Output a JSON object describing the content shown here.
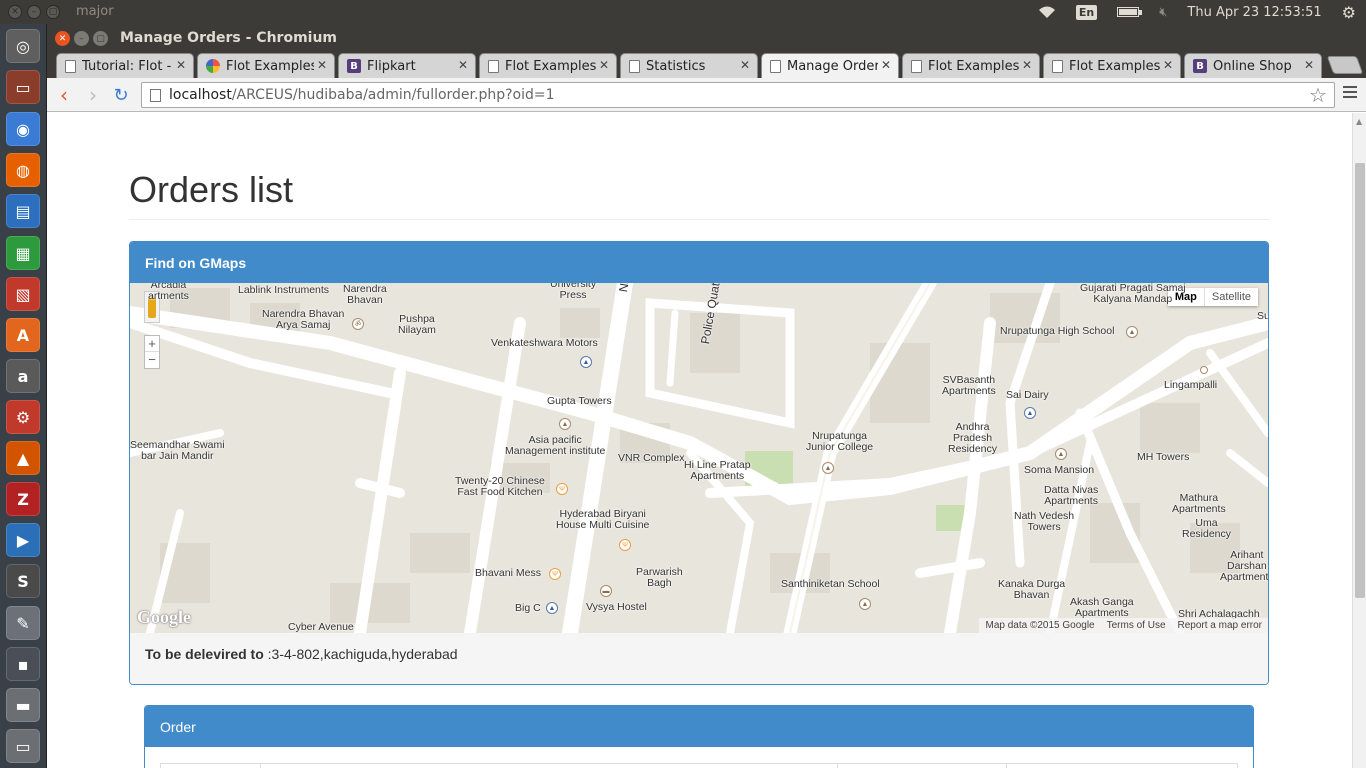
{
  "system": {
    "hostname": "major",
    "language": "En",
    "clock": "Thu Apr 23 12:53:51",
    "battery_level": 0.95
  },
  "launcher": {
    "items": [
      {
        "name": "dash-home-icon",
        "color": "#5f5f5f",
        "glyph": "◎"
      },
      {
        "name": "file-manager-icon",
        "color": "#8a3d2b",
        "glyph": "▭"
      },
      {
        "name": "chromium-icon",
        "color": "#3a7bd5",
        "glyph": "◉"
      },
      {
        "name": "firefox-icon",
        "color": "#e66000",
        "glyph": "◍"
      },
      {
        "name": "libreoffice-writer-icon",
        "color": "#2c6fbf",
        "glyph": "▤"
      },
      {
        "name": "libreoffice-calc-icon",
        "color": "#2e9a3e",
        "glyph": "▦"
      },
      {
        "name": "libreoffice-impress-icon",
        "color": "#c0392b",
        "glyph": "▧"
      },
      {
        "name": "software-center-icon",
        "color": "#e2661e",
        "glyph": "A"
      },
      {
        "name": "amazon-icon",
        "color": "#5a5a5a",
        "glyph": "a"
      },
      {
        "name": "system-settings-icon",
        "color": "#c0392b",
        "glyph": "⚙"
      },
      {
        "name": "vlc-icon",
        "color": "#d35400",
        "glyph": "▲"
      },
      {
        "name": "filezilla-icon",
        "color": "#b22222",
        "glyph": "Z"
      },
      {
        "name": "media-player-icon",
        "color": "#2a6fb8",
        "glyph": "▶"
      },
      {
        "name": "sublime-text-icon",
        "color": "#4a4a4a",
        "glyph": "S"
      },
      {
        "name": "text-editor-icon",
        "color": "#6b7079",
        "glyph": "✎"
      },
      {
        "name": "workspace-switcher-icon",
        "color": "#4a4f57",
        "glyph": "▪"
      },
      {
        "name": "drive-icon",
        "color": "#6b6f74",
        "glyph": "▬"
      },
      {
        "name": "trash-icon",
        "color": "#6b6f74",
        "glyph": "▭"
      }
    ]
  },
  "window": {
    "title": "Manage Orders - Chromium"
  },
  "tabs": [
    {
      "label": "Tutorial: Flot - ",
      "favicon": "page",
      "active": false
    },
    {
      "label": "Flot Examples",
      "favicon": "flot",
      "active": false
    },
    {
      "label": "Flipkart",
      "favicon": "bs",
      "active": false
    },
    {
      "label": "Flot Examples: ",
      "favicon": "page",
      "active": false
    },
    {
      "label": "Statistics",
      "favicon": "page",
      "active": false
    },
    {
      "label": "Manage Orders",
      "favicon": "page",
      "active": true
    },
    {
      "label": "Flot Examples",
      "favicon": "page",
      "active": false
    },
    {
      "label": "Flot Examples: ",
      "favicon": "page",
      "active": false
    },
    {
      "label": "Online Shop",
      "favicon": "bs",
      "active": false
    }
  ],
  "address_bar": {
    "host": "localhost",
    "path": "/ARCEUS/hudibaba/admin/fullorder.php?oid=1"
  },
  "page": {
    "title": "Orders list",
    "gmaps_panel": {
      "heading": "Find on GMaps",
      "delivery_label": "To be delevired to",
      "delivery_address": " :3-4-802,kachiguda,hyderabad"
    },
    "order_panel": {
      "heading": "Order"
    }
  },
  "map": {
    "map_type": {
      "map": "Map",
      "satellite": "Satellite"
    },
    "zoom_in": "+",
    "zoom_out": "−",
    "logo": "Google",
    "footer": {
      "data": "Map data ©2015 Google",
      "terms": "Terms of Use",
      "report": "Report a map error"
    },
    "labels": [
      {
        "id": "arcadia",
        "text": "Arcadia\nartments"
      },
      {
        "id": "lablink",
        "text": "Lablink Instruments"
      },
      {
        "id": "narendra-bhavan",
        "text": "Narendra\nBhavan"
      },
      {
        "id": "narendra-arya",
        "text": "Narendra Bhavan\nArya Samaj"
      },
      {
        "id": "pushpa",
        "text": "Pushpa\nNilayam"
      },
      {
        "id": "univ-press",
        "text": "University\nPress"
      },
      {
        "id": "nara-rd",
        "text": "Nara"
      },
      {
        "id": "police-quarter",
        "text": "Police Quater Rd"
      },
      {
        "id": "gujarati",
        "text": "Gujarati Pragati Samaj\nKalyana Mandap"
      },
      {
        "id": "su",
        "text": "Su"
      },
      {
        "id": "nrupatunga-high",
        "text": "Nrupatunga High School"
      },
      {
        "id": "venkateshwara",
        "text": "Venkateshwara Motors"
      },
      {
        "id": "lingampalli",
        "text": "Lingampalli"
      },
      {
        "id": "svbasanth",
        "text": "SVBasanth\nApartments"
      },
      {
        "id": "sai-dairy",
        "text": "Sai Dairy"
      },
      {
        "id": "gupta",
        "text": "Gupta Towers"
      },
      {
        "id": "seemandhar",
        "text": "Seemandhar Swami\nbar Jain Mandir"
      },
      {
        "id": "asia-pacific",
        "text": "Asia pacific\nManagement institute"
      },
      {
        "id": "vnr",
        "text": "VNR Complex"
      },
      {
        "id": "hi-line",
        "text": "Hi Line Pratap\nApartments"
      },
      {
        "id": "nrupatunga-jr",
        "text": "Nrupatunga\nJunior College"
      },
      {
        "id": "andhra",
        "text": "Andhra\nPradesh\nResidency"
      },
      {
        "id": "mh-towers",
        "text": "MH Towers"
      },
      {
        "id": "soma",
        "text": "Soma Mansion"
      },
      {
        "id": "twenty-20",
        "text": "Twenty-20 Chinese\nFast Food Kitchen"
      },
      {
        "id": "datta",
        "text": "Datta Nivas\nApartments"
      },
      {
        "id": "mathura",
        "text": "Mathura\nApartments"
      },
      {
        "id": "nath-vedesh",
        "text": "Nath Vedesh\nTowers"
      },
      {
        "id": "uma",
        "text": "Uma\nResidency"
      },
      {
        "id": "hyd-biryani",
        "text": "Hyderabad Biryani\nHouse Multi Cuisine"
      },
      {
        "id": "arihant",
        "text": "Arihant\nDarshan\nApartments"
      },
      {
        "id": "parwarish",
        "text": "Parwarish\nBagh"
      },
      {
        "id": "bhavani",
        "text": "Bhavani Mess"
      },
      {
        "id": "santhiniketan",
        "text": "Santhiniketan School"
      },
      {
        "id": "kanaka",
        "text": "Kanaka Durga\nBhavan"
      },
      {
        "id": "big-c",
        "text": "Big C"
      },
      {
        "id": "vysya",
        "text": "Vysya Hostel"
      },
      {
        "id": "akash",
        "text": "Akash Ganga\nApartments"
      },
      {
        "id": "shri-achala",
        "text": "Shri Achalagachh"
      },
      {
        "id": "cyber-avenue",
        "text": "Cyber Avenue"
      }
    ]
  }
}
